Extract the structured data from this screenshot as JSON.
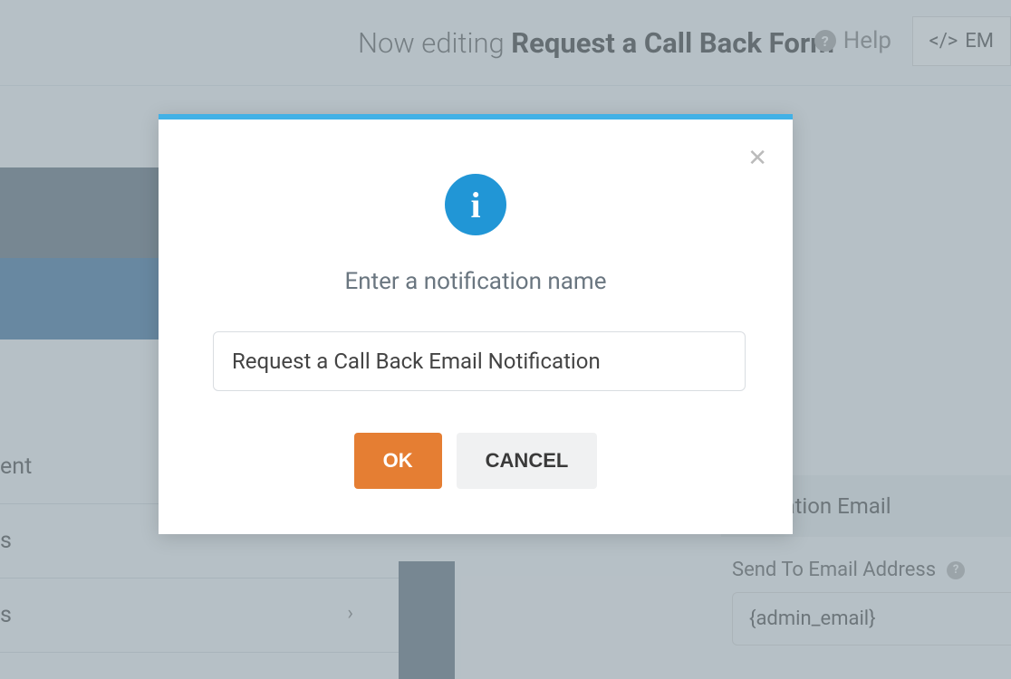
{
  "header": {
    "editing_prefix": "Now editing ",
    "form_name": "Request a Call Back Form",
    "help_label": "Help",
    "embed_label": "EM"
  },
  "sidebar": {
    "item1_suffix": "ent",
    "item2_suffix": "s",
    "item3_suffix": "s"
  },
  "rightPanel": {
    "confirmation_tab": "firmation Email",
    "send_to_label": "Send To Email Address",
    "admin_email_value": "{admin_email}"
  },
  "modal": {
    "prompt": "Enter a notification name",
    "input_value": "Request a Call Back Email Notification",
    "ok_label": "OK",
    "cancel_label": "CANCEL"
  }
}
